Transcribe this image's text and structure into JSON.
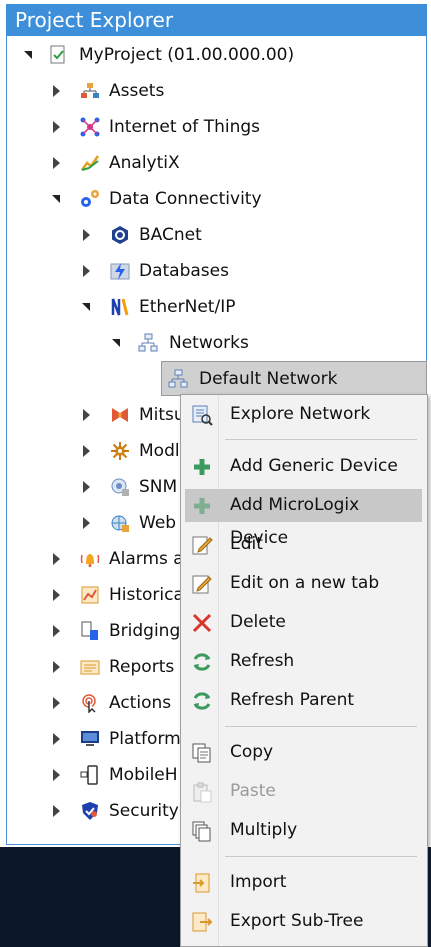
{
  "panel": {
    "title": "Project Explorer"
  },
  "tree": {
    "root": "MyProject (01.00.000.00)",
    "items": {
      "assets": "Assets",
      "iot": "Internet of Things",
      "analytix": "AnalytiX",
      "data_connectivity": "Data Connectivity",
      "bacnet": "BACnet",
      "databases": "Databases",
      "ethernetip": "EtherNet/IP",
      "networks": "Networks",
      "default_network": "Default Network",
      "mitsubishi": "Mitsu",
      "modbus": "Modl",
      "snmp": "SNM",
      "web": "Web",
      "alarms": "Alarms a",
      "historical": "Historica",
      "bridging": "Bridging",
      "reports": "Reports",
      "actions": "Actions",
      "platform": "Platform",
      "mobilehmi": "MobileH",
      "security": "Security"
    }
  },
  "context_menu": {
    "explore_network": "Explore Network",
    "add_generic_device": "Add Generic Device",
    "add_micrologix_device": "Add MicroLogix Device",
    "edit": "Edit",
    "edit_new_tab": "Edit on a new tab",
    "delete": "Delete",
    "refresh": "Refresh",
    "refresh_parent": "Refresh Parent",
    "copy": "Copy",
    "paste": "Paste",
    "multiply": "Multiply",
    "import": "Import",
    "export_sub_tree": "Export Sub-Tree"
  },
  "colors": {
    "title_bar": "#3c8fd8",
    "hover": "#c8c8c8",
    "selected": "#d0d0d0",
    "add_green": "#3c9a5f",
    "delete_red": "#d9342b"
  }
}
